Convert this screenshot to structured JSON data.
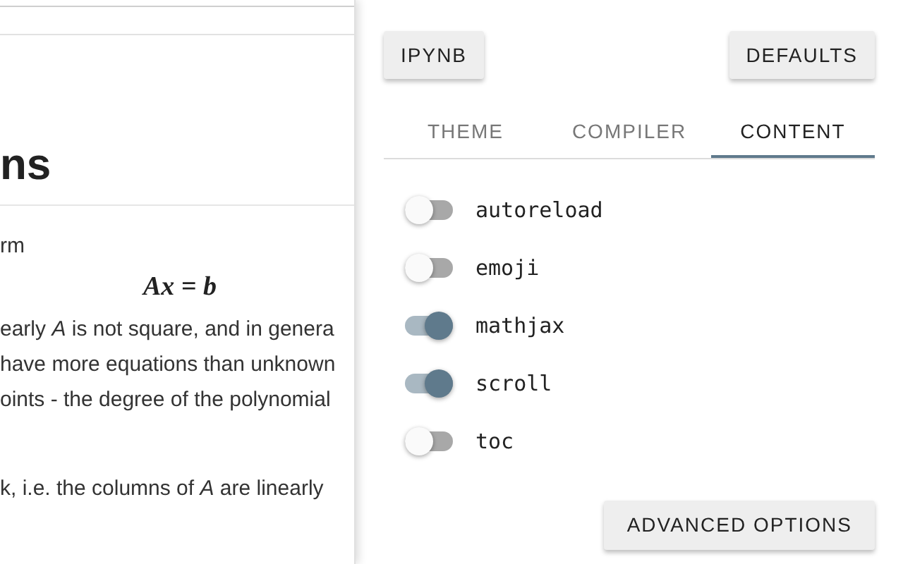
{
  "document": {
    "heading": "ns",
    "blocks": [
      {
        "kind": "text",
        "text": "rm"
      },
      {
        "kind": "equation",
        "text": "Ax = b"
      },
      {
        "kind": "text",
        "text": "early *A* is not square, and in genera"
      },
      {
        "kind": "text",
        "text": "have more equations than unknown"
      },
      {
        "kind": "text",
        "text": "oints - the degree of the polynomial"
      },
      {
        "kind": "gap"
      },
      {
        "kind": "text",
        "text": "k, i.e. the columns of *A* are linearly"
      }
    ]
  },
  "settings": {
    "buttons": [
      "IPYNB",
      "DEFAULTS"
    ],
    "tabs": [
      {
        "label": "THEME",
        "selected": false
      },
      {
        "label": "COMPILER",
        "selected": false
      },
      {
        "label": "CONTENT",
        "selected": true
      }
    ],
    "toggles": [
      {
        "label": "autoreload",
        "on": false
      },
      {
        "label": "emoji",
        "on": false
      },
      {
        "label": "mathjax",
        "on": true
      },
      {
        "label": "scroll",
        "on": true
      },
      {
        "label": "toc",
        "on": false
      }
    ],
    "advanced_button": "ADVANCED OPTIONS"
  }
}
